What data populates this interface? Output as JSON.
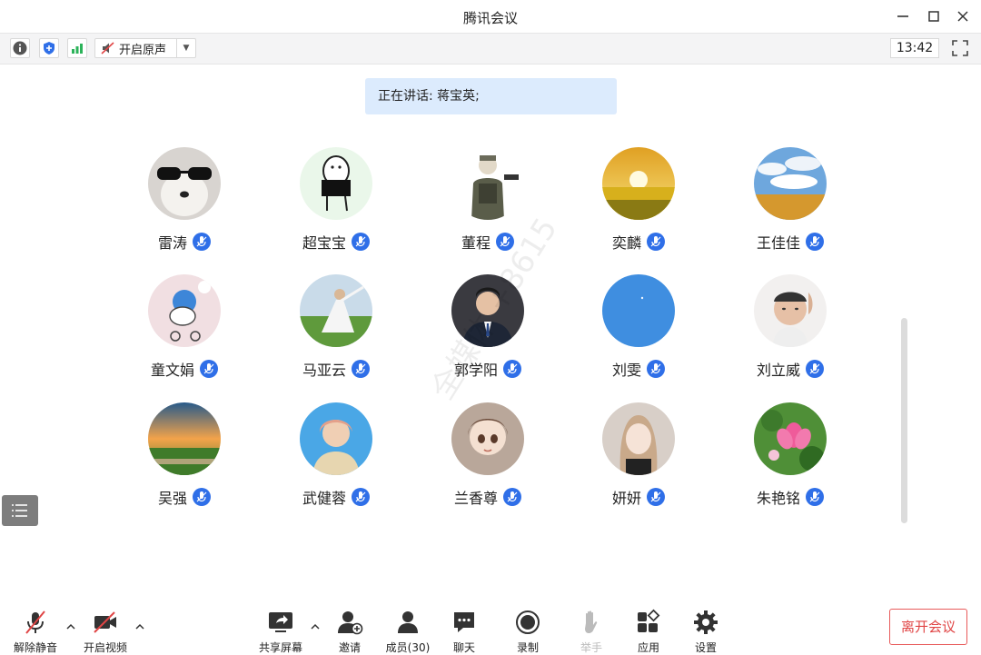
{
  "window": {
    "title": "腾讯会议"
  },
  "toolbar": {
    "original_sound_label": "开启原声",
    "clock": "13:42",
    "icons": [
      "info-icon",
      "shield-icon",
      "signal-icon",
      "speaker-muted-icon",
      "dropdown-icon",
      "fullscreen-icon"
    ]
  },
  "speaking_banner": "正在讲话: 蒋宝英;",
  "participants": [
    {
      "name": "雷涛"
    },
    {
      "name": "超宝宝"
    },
    {
      "name": "董程"
    },
    {
      "name": "奕麟"
    },
    {
      "name": "王佳佳"
    },
    {
      "name": "童文娟"
    },
    {
      "name": "马亚云"
    },
    {
      "name": "郭学阳"
    },
    {
      "name": "刘雯"
    },
    {
      "name": "刘立威"
    },
    {
      "name": "吴强"
    },
    {
      "name": "武健蓉"
    },
    {
      "name": "兰香尊"
    },
    {
      "name": "妍妍"
    },
    {
      "name": "朱艳铭"
    }
  ],
  "bottom": {
    "unmute": "解除静音",
    "start_video": "开启视频",
    "share_screen": "共享屏幕",
    "invite": "邀请",
    "members": "成员(30)",
    "chat": "聊天",
    "record": "录制",
    "raise_hand": "举手",
    "apps": "应用",
    "settings": "设置",
    "leave": "离开会议"
  },
  "colors": {
    "accent": "#2f6fe8",
    "leave": "#e04545",
    "banner": "#dcebfd"
  }
}
